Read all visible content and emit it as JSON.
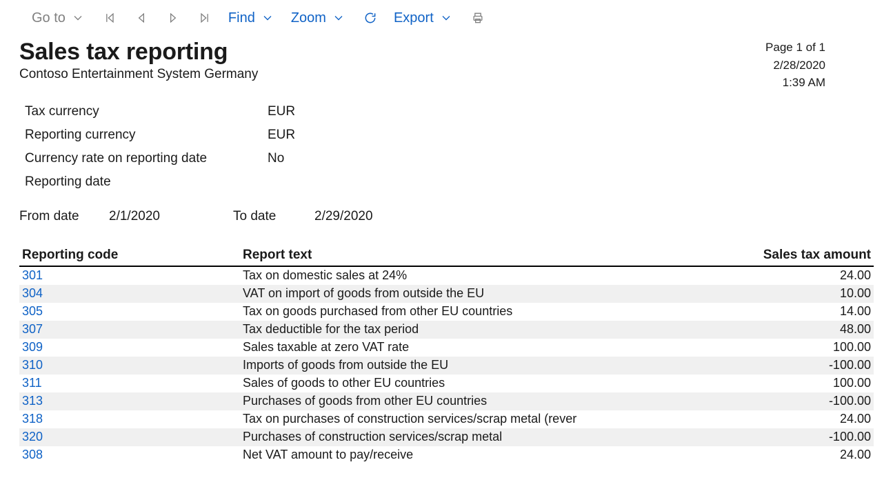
{
  "toolbar": {
    "goto": "Go to",
    "find": "Find",
    "zoom": "Zoom",
    "export": "Export"
  },
  "report": {
    "title": "Sales tax reporting",
    "company": "Contoso Entertainment System Germany",
    "page_meta": {
      "page_label": "Page 1 of 1",
      "date": "2/28/2020",
      "time": "1:39 AM"
    },
    "info": {
      "tax_currency_label": "Tax currency",
      "tax_currency_value": "EUR",
      "reporting_currency_label": "Reporting currency",
      "reporting_currency_value": "EUR",
      "currency_rate_label": "Currency rate on reporting date",
      "currency_rate_value": "No",
      "reporting_date_label": "Reporting date",
      "reporting_date_value": ""
    },
    "dates": {
      "from_label": "From date",
      "from_value": "2/1/2020",
      "to_label": "To date",
      "to_value": "2/29/2020"
    },
    "columns": {
      "code": "Reporting code",
      "text": "Report text",
      "amount": "Sales tax amount"
    },
    "rows": [
      {
        "code": "301",
        "text": "Tax on domestic sales at 24%",
        "amount": "24.00"
      },
      {
        "code": "304",
        "text": "VAT on import of goods from outside the EU",
        "amount": "10.00"
      },
      {
        "code": "305",
        "text": "Tax on goods purchased from other EU countries",
        "amount": "14.00"
      },
      {
        "code": "307",
        "text": "Tax deductible for the tax period",
        "amount": "48.00"
      },
      {
        "code": "309",
        "text": "Sales taxable at zero VAT rate",
        "amount": "100.00"
      },
      {
        "code": "310",
        "text": "Imports of goods from outside the EU",
        "amount": "-100.00"
      },
      {
        "code": "311",
        "text": "Sales of goods to other EU countries",
        "amount": "100.00"
      },
      {
        "code": "313",
        "text": "Purchases of goods from other EU countries",
        "amount": "-100.00"
      },
      {
        "code": "318",
        "text": "Tax on purchases of construction services/scrap metal (rever",
        "amount": "24.00"
      },
      {
        "code": "320",
        "text": "Purchases of construction services/scrap metal",
        "amount": "-100.00"
      },
      {
        "code": "308",
        "text": "Net VAT amount to pay/receive",
        "amount": "24.00"
      }
    ]
  }
}
